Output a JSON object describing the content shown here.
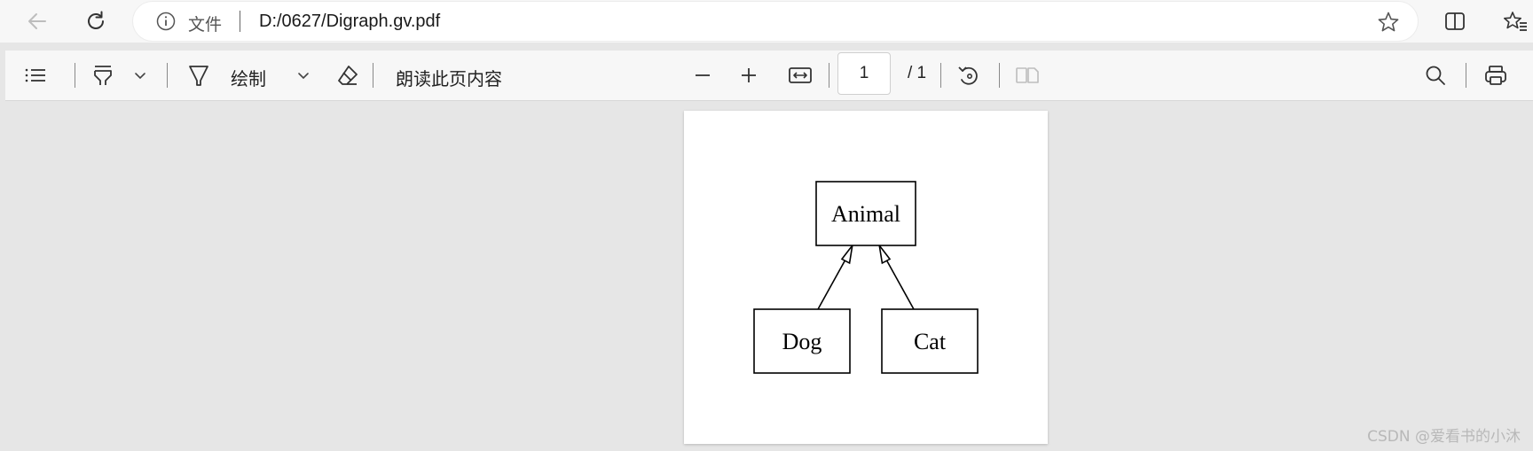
{
  "browser": {
    "url_scheme": "文件",
    "url": "D:/0627/Digraph.gv.pdf",
    "icons": [
      "back-icon",
      "refresh-icon",
      "info-icon",
      "favorite-star-icon",
      "split-screen-icon",
      "favorites-icon"
    ]
  },
  "toolbar": {
    "draw_label": "绘制",
    "read_aloud_label": "朗读此页内容",
    "page_current": "1",
    "page_total": "/ 1",
    "icons": [
      "contents-icon",
      "highlight-icon",
      "draw-icon",
      "erase-icon",
      "zoom-out-icon",
      "zoom-in-icon",
      "fit-page-icon",
      "rotate-icon",
      "page-view-icon",
      "search-icon",
      "print-icon"
    ]
  },
  "document": {
    "graph": {
      "nodes": [
        {
          "id": "animal",
          "label": "Animal"
        },
        {
          "id": "dog",
          "label": "Dog"
        },
        {
          "id": "cat",
          "label": "Cat"
        }
      ],
      "edges": [
        {
          "from": "dog",
          "to": "animal",
          "arrowhead": "empty"
        },
        {
          "from": "cat",
          "to": "animal",
          "arrowhead": "empty"
        }
      ]
    }
  },
  "watermark": "CSDN @爱看书的小沐"
}
